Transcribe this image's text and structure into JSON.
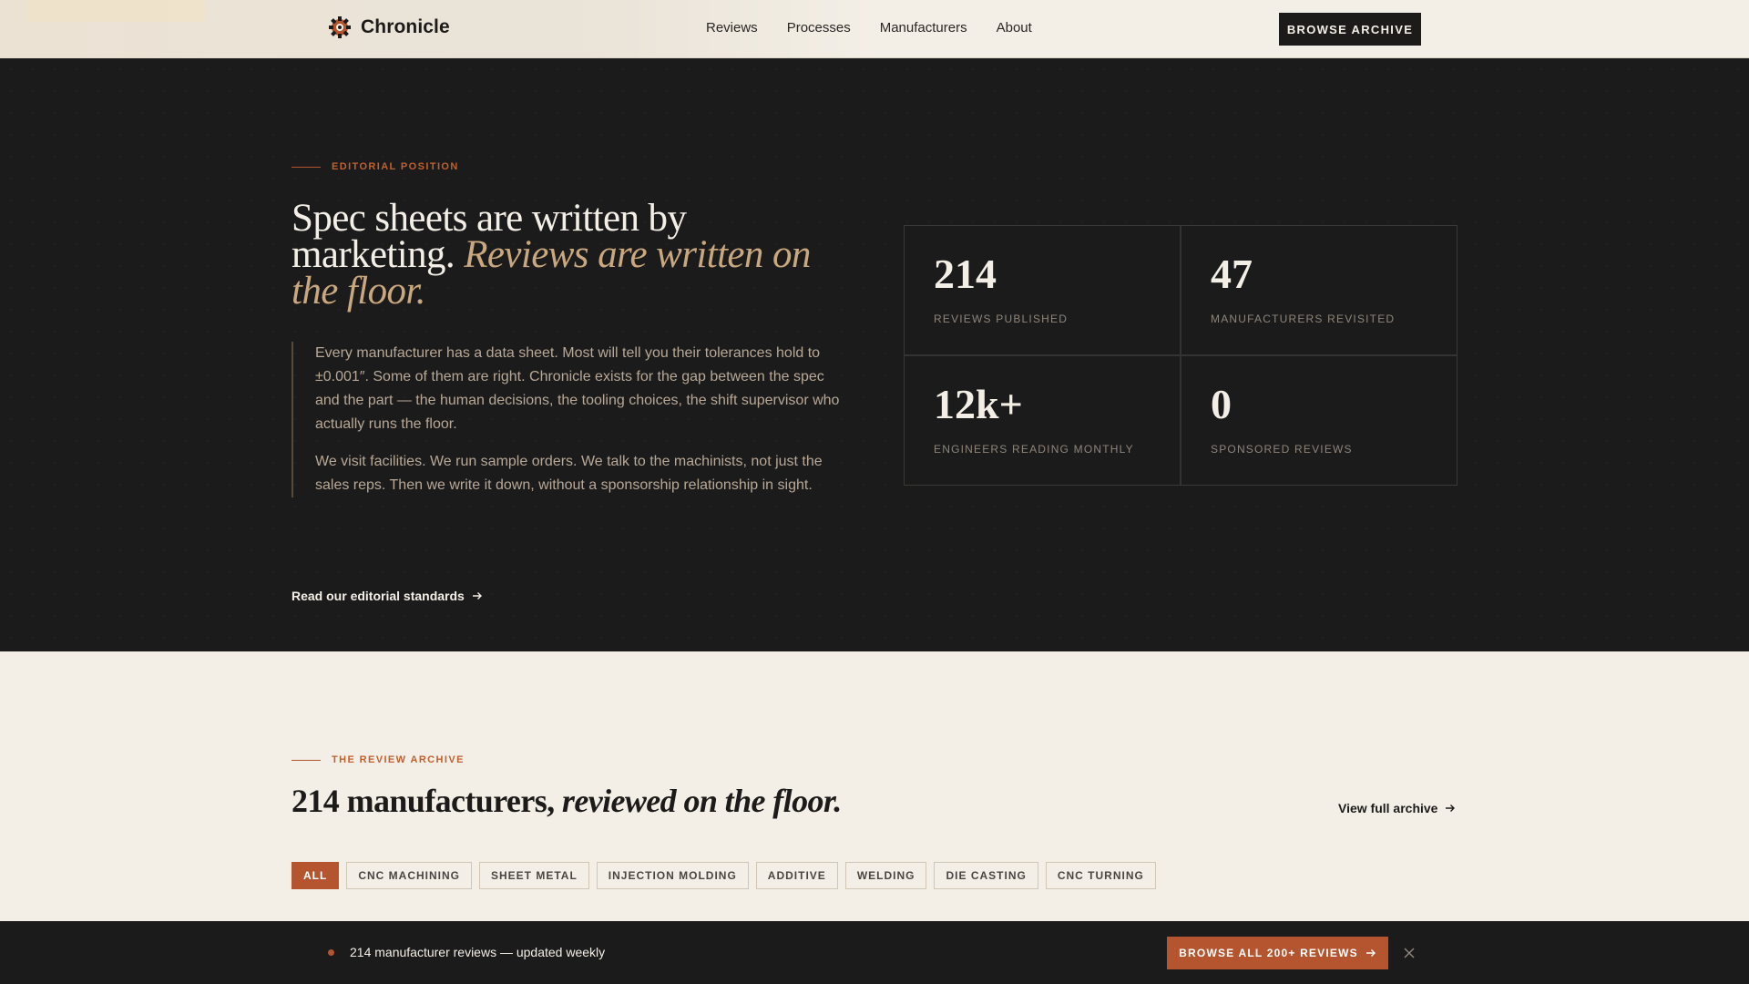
{
  "nav": {
    "brand": "Chronicle",
    "links": [
      "Reviews",
      "Processes",
      "Manufacturers",
      "About"
    ],
    "cta": "Browse Archive"
  },
  "hero": {
    "eyebrow": "Editorial Position",
    "title_plain": "Spec sheets are written by marketing.",
    "title_italic": "Reviews are written on the floor.",
    "body": [
      "Every manufacturer has a data sheet. Most will tell you their tolerances hold to ±0.001″. Some of them are right. Chronicle exists for the gap between the spec and the part — the human decisions, the tooling choices, the shift supervisor who actually runs the floor.",
      "We visit facilities. We run sample orders. We talk to the machinists, not just the sales reps. Then we write it down, without a sponsorship relationship in sight."
    ],
    "link": "Read our editorial standards",
    "stats": [
      {
        "value": "214",
        "label": "Reviews Published"
      },
      {
        "value": "47",
        "label": "Manufacturers Revisited"
      },
      {
        "value": "12k+",
        "label": "Engineers Reading Monthly"
      },
      {
        "value": "0",
        "label": "Sponsored Reviews"
      }
    ]
  },
  "archive": {
    "eyebrow": "The Review Archive",
    "title_plain": "214 manufacturers,",
    "title_italic": "reviewed on the floor.",
    "link": "View full archive",
    "chips": [
      "All",
      "CNC Machining",
      "Sheet Metal",
      "Injection Molding",
      "Additive",
      "Welding",
      "Die Casting",
      "CNC Turning"
    ],
    "active_chip": "All"
  },
  "bottom_bar": {
    "text": "214 manufacturer reviews — updated weekly",
    "cta": "Browse all 200+ reviews"
  },
  "colors": {
    "accent": "#b4552f",
    "dark": "#1b1b1b",
    "cream": "#f4efe6",
    "tan": "#c9a77f"
  }
}
